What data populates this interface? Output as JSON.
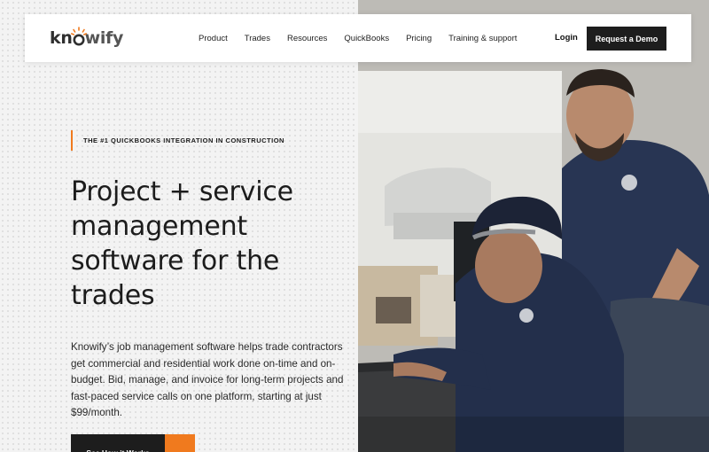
{
  "brand": {
    "name_part1": "kn",
    "name_part2": "wify",
    "accent_color": "#f07a1e",
    "dark_color": "#1d1d1d"
  },
  "nav": {
    "items": [
      {
        "label": "Product"
      },
      {
        "label": "Trades"
      },
      {
        "label": "Resources"
      },
      {
        "label": "QuickBooks"
      },
      {
        "label": "Pricing"
      },
      {
        "label": "Training & support"
      }
    ],
    "login_label": "Login",
    "demo_label": "Request a Demo"
  },
  "hero": {
    "eyebrow": "THE #1 QUICKBOOKS INTEGRATION IN CONSTRUCTION",
    "headline": "Project + service management software for the trades",
    "lead": "Knowify’s job management software helps trade contractors get commercial and residential work done on-time and on-budget. Bid, manage, and invoice for long-term projects and fast-paced service calls on one platform, starting at just $99/month.",
    "cta_label": "See How it Works",
    "cta_icon": "arrow-right-icon",
    "cta_arrow_glyph": "→",
    "image_subject": "two contractors in navy polo shirts working at a desk computer"
  }
}
